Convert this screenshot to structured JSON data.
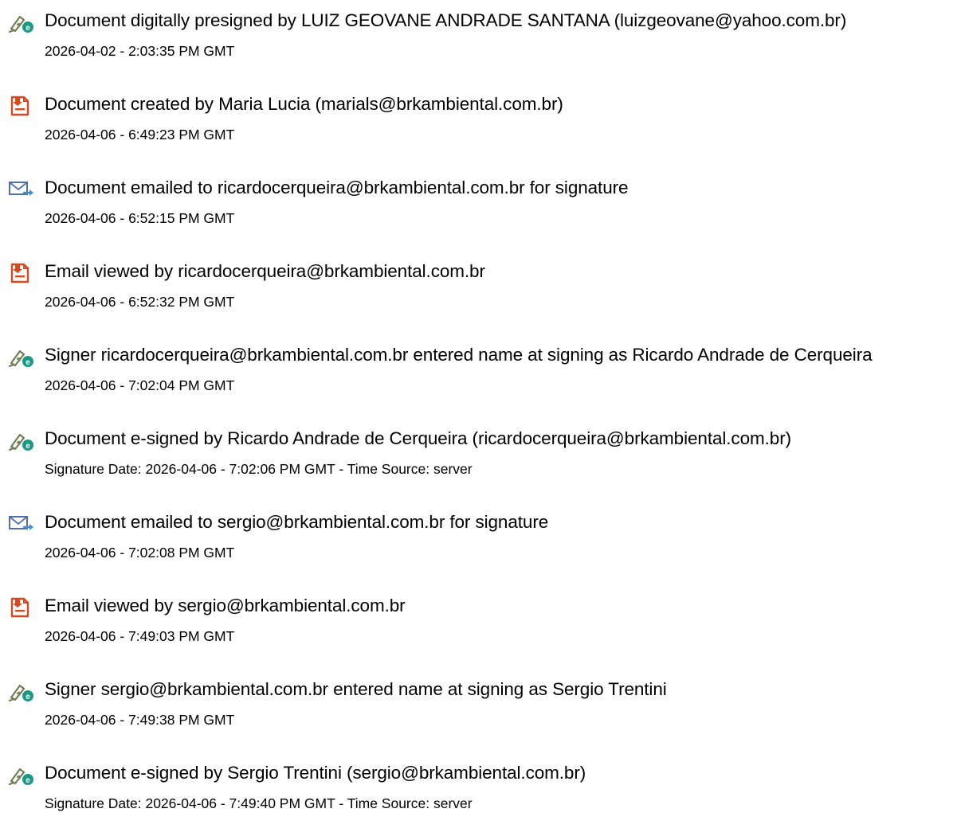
{
  "icon_colors": {
    "pen": "#6f7f52",
    "esign_badge": "#1a9a86",
    "document": "#d9481f",
    "email": "#4f6fae",
    "arrow": "#3d8fd1"
  },
  "events": [
    {
      "icon": "pen-e-sign-icon",
      "title": "Document digitally presigned by LUIZ GEOVANE ANDRADE SANTANA (luizgeovane@yahoo.com.br)",
      "time": "2026-04-02 - 2:03:35 PM GMT"
    },
    {
      "icon": "document-icon",
      "title": "Document created by Maria Lucia (marials@brkambiental.com.br)",
      "time": "2026-04-06 - 6:49:23 PM GMT"
    },
    {
      "icon": "email-sent-icon",
      "title": "Document emailed to ricardocerqueira@brkambiental.com.br for signature",
      "time": "2026-04-06 - 6:52:15 PM GMT"
    },
    {
      "icon": "document-icon",
      "title": "Email viewed by ricardocerqueira@brkambiental.com.br",
      "time": "2026-04-06 - 6:52:32 PM GMT"
    },
    {
      "icon": "pen-e-sign-icon",
      "title": "Signer ricardocerqueira@brkambiental.com.br entered name at signing as Ricardo Andrade de Cerqueira",
      "time": "2026-04-06 - 7:02:04 PM GMT"
    },
    {
      "icon": "pen-e-sign-icon",
      "title": "Document e-signed by Ricardo Andrade de Cerqueira (ricardocerqueira@brkambiental.com.br)",
      "time": "Signature Date: 2026-04-06 - 7:02:06 PM GMT - Time Source: server"
    },
    {
      "icon": "email-sent-icon",
      "title": "Document emailed to sergio@brkambiental.com.br for signature",
      "time": "2026-04-06 - 7:02:08 PM GMT"
    },
    {
      "icon": "document-icon",
      "title": "Email viewed by sergio@brkambiental.com.br",
      "time": "2026-04-06 - 7:49:03 PM GMT"
    },
    {
      "icon": "pen-e-sign-icon",
      "title": "Signer sergio@brkambiental.com.br entered name at signing as Sergio Trentini",
      "time": "2026-04-06 - 7:49:38 PM GMT"
    },
    {
      "icon": "pen-e-sign-icon",
      "title": "Document e-signed by Sergio Trentini (sergio@brkambiental.com.br)",
      "time": "Signature Date: 2026-04-06 - 7:49:40 PM GMT - Time Source: server"
    }
  ]
}
